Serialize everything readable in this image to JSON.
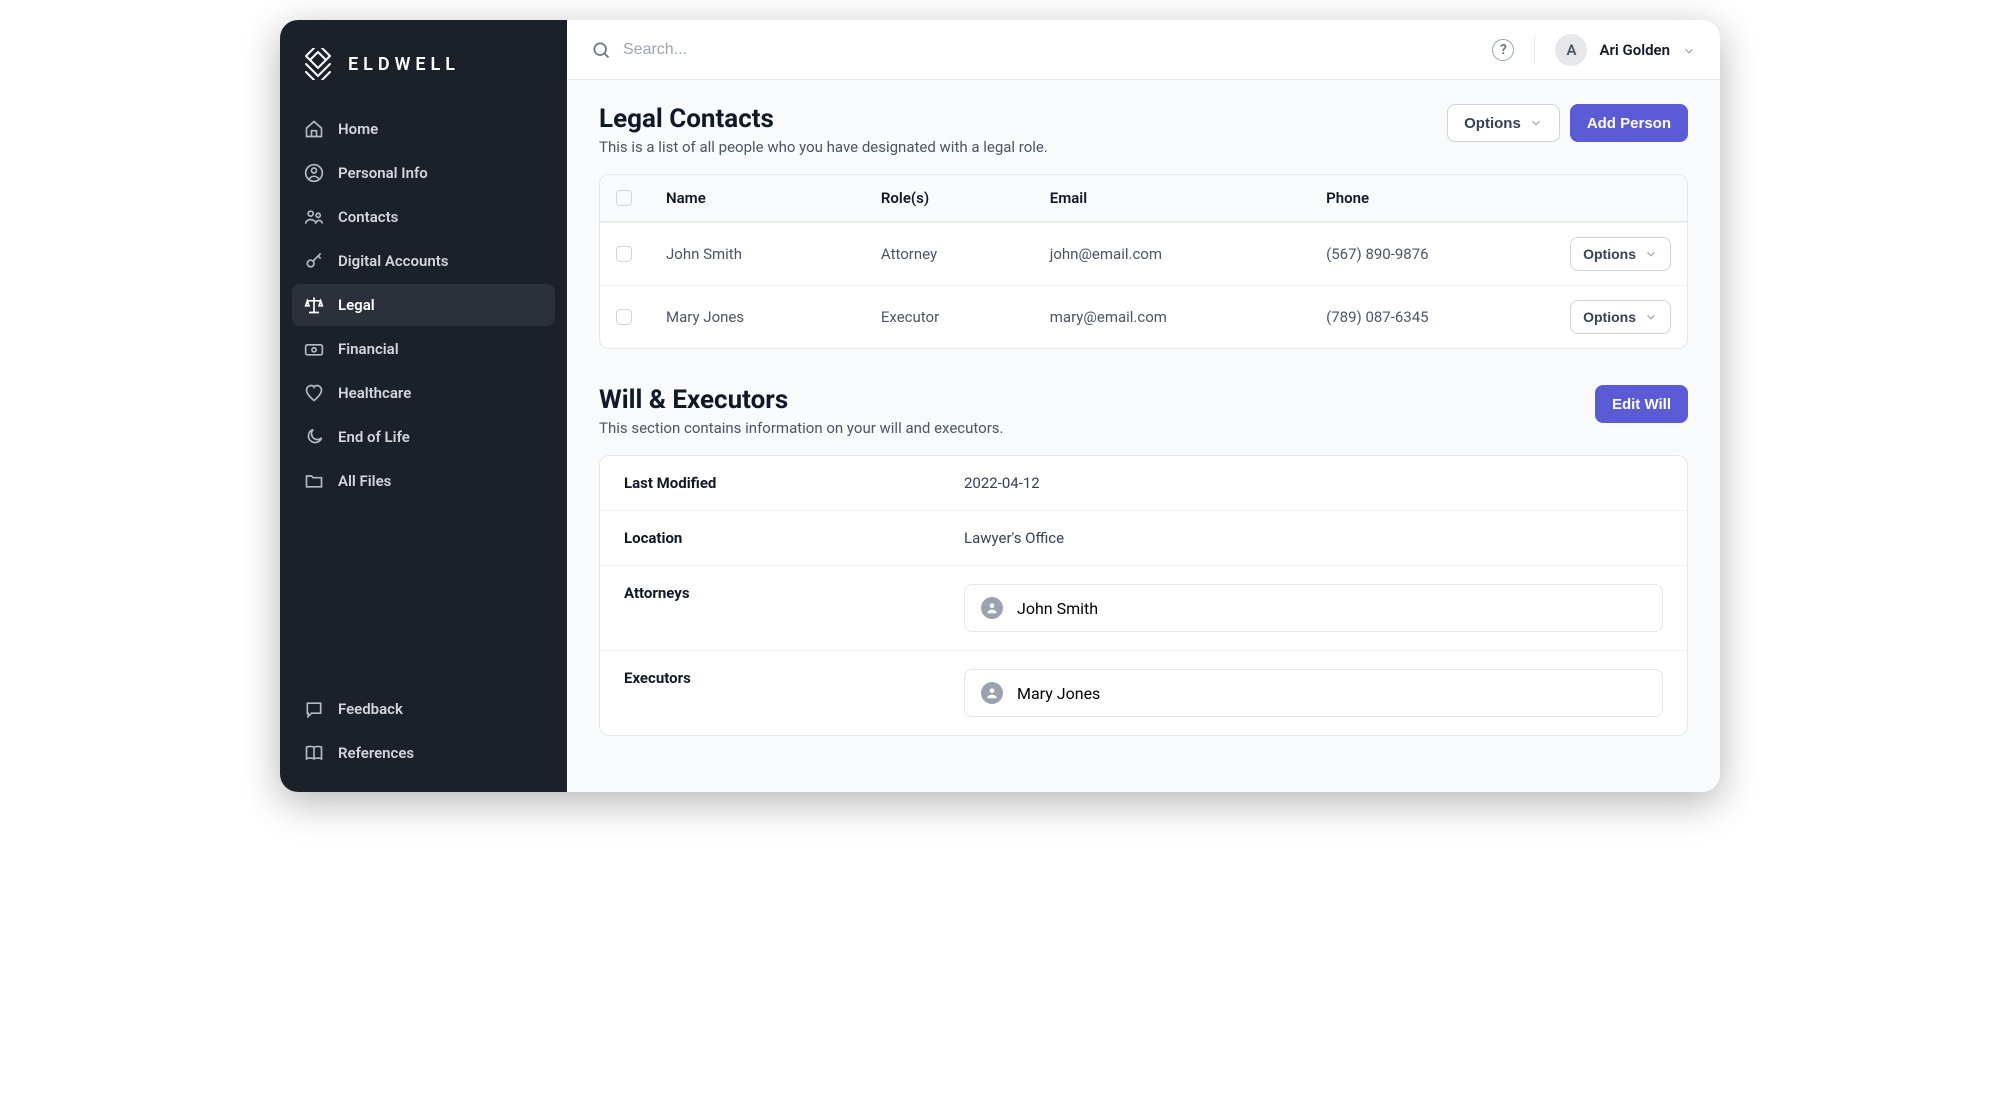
{
  "brand": {
    "name": "ELDWELL"
  },
  "sidebar": {
    "items": [
      {
        "label": "Home",
        "icon": "home-icon"
      },
      {
        "label": "Personal Info",
        "icon": "person-icon"
      },
      {
        "label": "Contacts",
        "icon": "people-icon"
      },
      {
        "label": "Digital Accounts",
        "icon": "key-icon"
      },
      {
        "label": "Legal",
        "icon": "scales-icon",
        "active": true
      },
      {
        "label": "Financial",
        "icon": "money-icon"
      },
      {
        "label": "Healthcare",
        "icon": "heart-icon"
      },
      {
        "label": "End of Life",
        "icon": "moon-icon"
      },
      {
        "label": "All Files",
        "icon": "folder-icon"
      }
    ],
    "bottom": [
      {
        "label": "Feedback",
        "icon": "chat-icon"
      },
      {
        "label": "References",
        "icon": "book-icon"
      }
    ]
  },
  "topbar": {
    "search_placeholder": "Search...",
    "user_initial": "A",
    "user_name": "Ari Golden"
  },
  "legal_contacts": {
    "title": "Legal Contacts",
    "subtitle": "This is a list of all people who you have designated with a legal role.",
    "options_label": "Options",
    "add_label": "Add Person",
    "columns": {
      "name": "Name",
      "roles": "Role(s)",
      "email": "Email",
      "phone": "Phone"
    },
    "rows": [
      {
        "name": "John Smith",
        "role": "Attorney",
        "email": "john@email.com",
        "phone": "(567) 890-9876",
        "options_label": "Options"
      },
      {
        "name": "Mary Jones",
        "role": "Executor",
        "email": "mary@email.com",
        "phone": "(789) 087-6345",
        "options_label": "Options"
      }
    ]
  },
  "will": {
    "title": "Will & Executors",
    "subtitle": "This section contains information on your will and executors.",
    "edit_label": "Edit Will",
    "fields": {
      "last_modified_label": "Last Modified",
      "last_modified_value": "2022-04-12",
      "location_label": "Location",
      "location_value": "Lawyer's Office",
      "attorneys_label": "Attorneys",
      "executors_label": "Executors"
    },
    "attorneys": [
      {
        "name": "John Smith"
      }
    ],
    "executors": [
      {
        "name": "Mary Jones"
      }
    ]
  }
}
